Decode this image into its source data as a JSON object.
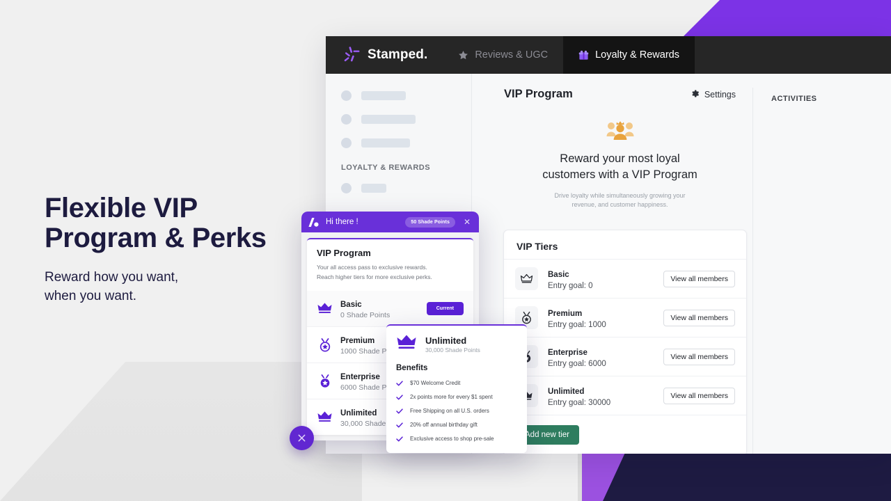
{
  "hero": {
    "headline_line1": "Flexible VIP",
    "headline_line2": "Program & Perks",
    "sub_line1": "Reward how you want,",
    "sub_line2": "when you want."
  },
  "topbar": {
    "brand": "Stamped.",
    "tabs": [
      {
        "label": "Reviews & UGC",
        "icon": "star-icon",
        "active": false
      },
      {
        "label": "Loyalty & Rewards",
        "icon": "gift-icon",
        "active": true
      }
    ]
  },
  "sidebar": {
    "section_label": "LOYALTY & REWARDS",
    "skeleton_widths": [
      64,
      78,
      70
    ],
    "skeleton_widths_lower": [
      36
    ]
  },
  "rail": {
    "title": "ACTIVITIES"
  },
  "page": {
    "title": "VIP Program",
    "settings_label": "Settings",
    "empty_heading_line1": "Reward your most loyal",
    "empty_heading_line2": "customers with a VIP Program",
    "empty_sub_line1": "Drive loyalty while simultaneously growing your",
    "empty_sub_line2": "revenue, and customer happiness."
  },
  "tiers_card": {
    "title": "VIP Tiers",
    "view_label": "View all members",
    "add_label": "Add new tier",
    "rows": [
      {
        "name": "Basic",
        "goal": "Entry goal: 0",
        "icon": "crown-outline-icon"
      },
      {
        "name": "Premium",
        "goal": "Entry goal: 1000",
        "icon": "medal-star-icon"
      },
      {
        "name": "Enterprise",
        "goal": "Entry goal: 6000",
        "icon": "medal-star-icon"
      },
      {
        "name": "Unlimited",
        "goal": "Entry goal: 30000",
        "icon": "crown-solid-icon"
      }
    ]
  },
  "widget": {
    "greeting": "Hi there !",
    "points_badge": "50 Shade Points",
    "close_icon": "close-icon",
    "card_title": "VIP Program",
    "card_desc_line1": "Your all access pass to exclusive rewards.",
    "card_desc_line2": "Reach higher tiers for more exclusive perks.",
    "current_badge": "Current",
    "tiers": [
      {
        "name": "Basic",
        "points": "0 Shade Points",
        "current": true
      },
      {
        "name": "Premium",
        "points": "1000 Shade Points",
        "current": false
      },
      {
        "name": "Enterprise",
        "points": "6000 Shade Points",
        "current": false
      },
      {
        "name": "Unlimited",
        "points": "30,000 Shade Points",
        "current": false
      }
    ]
  },
  "flyout": {
    "tier_name": "Unlimited",
    "tier_points": "30,000 Shade Points",
    "benefits_title": "Benefits",
    "benefits": [
      "$70 Welcome Credit",
      "2x points more for every $1 spent",
      "Free Shipping on all U.S. orders",
      "20% off annual birthday gift",
      "Exclusive access to shop pre-sale"
    ]
  },
  "colors": {
    "purple": "#6930d9",
    "purple_dark": "#5a21d6",
    "green": "#2e7d5f",
    "navy": "#1d1b3f",
    "orange": "#e8a33d"
  }
}
